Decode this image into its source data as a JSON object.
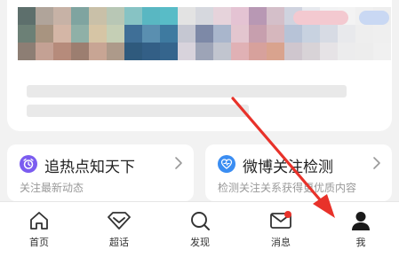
{
  "cards": [
    {
      "title": "追热点知天下",
      "subtitle": "关注最新动态",
      "icon": "alarm-clock-icon",
      "icon_color": "#7b5cf0"
    },
    {
      "title": "微博关注检测",
      "subtitle": "检测关注关系获得更优质内容",
      "icon": "heart-pulse-icon",
      "icon_color": "#3a8df2"
    }
  ],
  "tabbar": {
    "items": [
      {
        "label": "首页",
        "icon": "home-icon"
      },
      {
        "label": "超话",
        "icon": "diamond-icon"
      },
      {
        "label": "发现",
        "icon": "search-icon"
      },
      {
        "label": "消息",
        "icon": "mail-icon",
        "badge": true
      },
      {
        "label": "我",
        "icon": "profile-icon",
        "active": true
      }
    ]
  },
  "colors": {
    "badge": "#e8322a",
    "annotation_arrow": "#e8322a",
    "text_primary": "#222222",
    "text_secondary": "#999999"
  }
}
